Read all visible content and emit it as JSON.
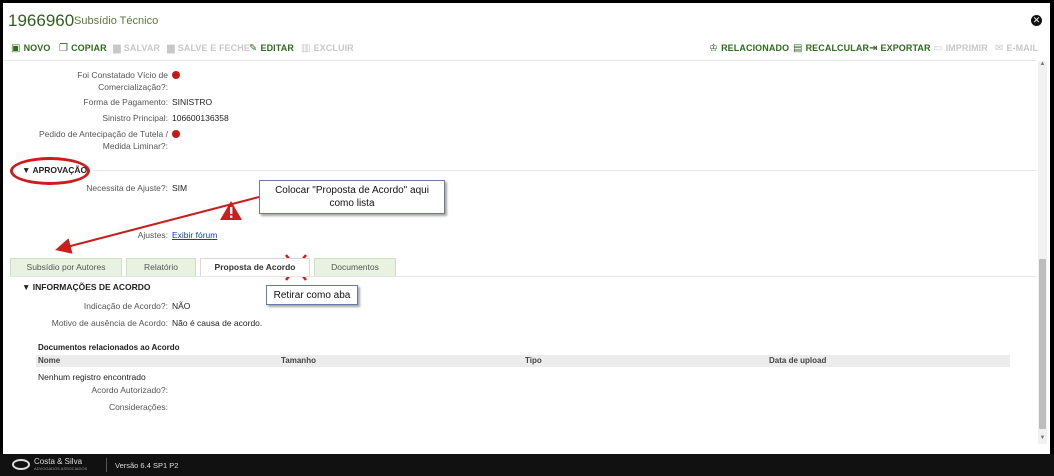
{
  "header": {
    "record_id": "1966960",
    "record_type": "Subsídio Técnico"
  },
  "toolbar": {
    "left": [
      {
        "label": "NOVO",
        "icon": "file-plus-icon",
        "enabled": true
      },
      {
        "label": "COPIAR",
        "icon": "copy-icon",
        "enabled": true
      },
      {
        "label": "SALVAR",
        "icon": "save-icon",
        "enabled": false
      },
      {
        "label": "SALVE E FECHE",
        "icon": "save-close-icon",
        "enabled": false
      },
      {
        "label": "EDITAR",
        "icon": "pencil-icon",
        "enabled": true
      },
      {
        "label": "EXCLUIR",
        "icon": "trash-icon",
        "enabled": false
      }
    ],
    "right": [
      {
        "label": "RELACIONADO",
        "icon": "sitemap-icon",
        "enabled": true
      },
      {
        "label": "RECALCULAR",
        "icon": "calculator-icon",
        "enabled": true
      },
      {
        "label": "EXPORTAR",
        "icon": "export-icon",
        "enabled": true
      },
      {
        "label": "IMPRIMIR",
        "icon": "print-icon",
        "enabled": false
      },
      {
        "label": "E-MAIL",
        "icon": "email-icon",
        "enabled": false
      }
    ]
  },
  "fields": {
    "vicio": {
      "label_1": "Foi Constatado Vício de",
      "label_2": "Comercialização?:",
      "value": "red-dot"
    },
    "pagamento": {
      "label": "Forma de Pagamento:",
      "value": "SINISTRO"
    },
    "sinistro": {
      "label": "Sinistro Principal:",
      "value": "106600136358"
    },
    "tutela": {
      "label_1": "Pedido de Antecipação de Tutela /",
      "label_2": "Medida Liminar?:",
      "value": "red-dot"
    }
  },
  "approval": {
    "section_title": "APROVAÇÃO",
    "ajuste_label": "Necessita de Ajuste?:",
    "ajuste_value": "SIM",
    "ajustes_label": "Ajustes:",
    "ajustes_link": "Exibir fórum"
  },
  "annotations": {
    "callout_1": "Colocar \"Proposta de Acordo\" aqui como lista",
    "callout_2": "Retirar como aba"
  },
  "tabs": [
    {
      "label": "Subsídio por Autores",
      "active": false
    },
    {
      "label": "Relatório",
      "active": false
    },
    {
      "label": "Proposta de Acordo",
      "active": true
    },
    {
      "label": "Documentos",
      "active": false
    }
  ],
  "acordo": {
    "section_title": "INFORMAÇÕES DE ACORDO",
    "indicacao_label": "Indicação de Acordo?:",
    "indicacao_value": "NÃO",
    "motivo_label": "Motivo de ausência de Acordo:",
    "motivo_value": "Não é causa de acordo.",
    "docs_title": "Documentos relacionados ao Acordo",
    "columns": [
      "Nome",
      "Tamanho",
      "Tipo",
      "Data de upload"
    ],
    "empty_text": "Nenhum registro encontrado",
    "autorizado_label": "Acordo Autorizado?:",
    "consideracoes_label": "Considerações:"
  },
  "footer": {
    "brand": "Costa & Silva",
    "brand_sub": "ADVOGADOS ASSOCIADOS",
    "version": "Versão 6.4 SP1 P2"
  },
  "colors": {
    "accent_green": "#2e6b1f",
    "alert_red": "#cc1d1d"
  }
}
